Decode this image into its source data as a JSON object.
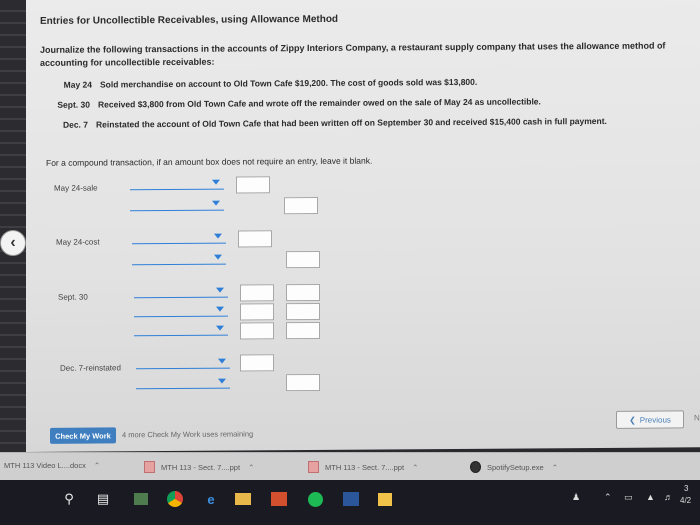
{
  "page": {
    "title": "Entries for Uncollectible Receivables, using Allowance Method",
    "intro": "Journalize the following transactions in the accounts of Zippy Interiors Company, a restaurant supply company that uses the allowance method of accounting for uncollectible receivables:"
  },
  "transactions": [
    {
      "date": "May 24",
      "text": "Sold merchandise on account to Old Town Cafe $19,200. The cost of goods sold was $13,800."
    },
    {
      "date": "Sept. 30",
      "text": "Received $3,800 from Old Town Cafe and wrote off the remainder owed on the sale of May 24 as uncollectible."
    },
    {
      "date": "Dec. 7",
      "text": "Reinstated the account of Old Town Cafe that had been written off on September 30 and received $15,400 cash in full payment."
    }
  ],
  "instruction": "For a compound transaction, if an amount box does not require an entry, leave it blank.",
  "entries": [
    {
      "label": "May 24-sale"
    },
    {
      "label": "May 24-cost"
    },
    {
      "label": "Sept. 30"
    },
    {
      "label": "Dec. 7-reinstated"
    }
  ],
  "footer": {
    "check_button": "Check My Work",
    "check_note": "4 more Check My Work uses remaining",
    "previous": "Previous",
    "next": "N"
  },
  "downloads": [
    {
      "name": "MTH 113 Video L....docx",
      "icon": "word-file-icon"
    },
    {
      "name": "MTH 113 - Sect. 7....ppt",
      "icon": "ppt-file-icon"
    },
    {
      "name": "MTH 113 - Sect. 7....ppt",
      "icon": "ppt-file-icon"
    },
    {
      "name": "SpotifySetup.exe",
      "icon": "spotify-icon"
    }
  ],
  "tray": {
    "time": "3",
    "date": "4/2"
  },
  "colors": {
    "accent": "#2f7fd8",
    "check_button": "#3f7fbf",
    "taskbar": "#1a1b22"
  }
}
